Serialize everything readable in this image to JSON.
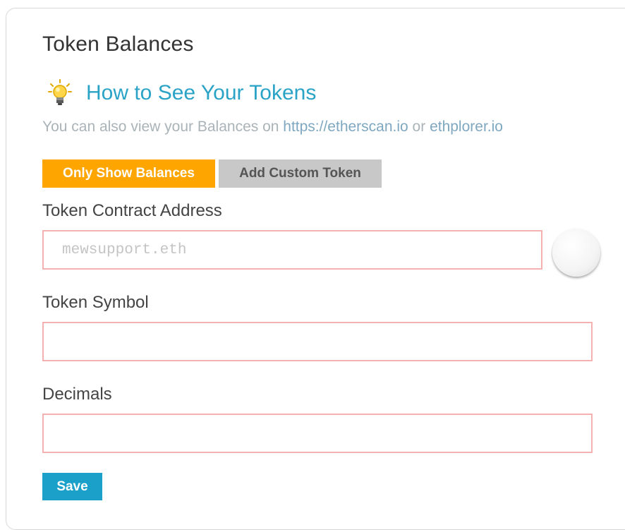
{
  "panel": {
    "title": "Token Balances",
    "help_link": "How to See Your Tokens",
    "info_prefix": "You can also view your Balances on ",
    "info_link_1": "https://etherscan.io",
    "info_middle": " or ",
    "info_link_2": "ethplorer.io"
  },
  "buttons": {
    "only_show_balances": "Only Show Balances",
    "add_custom_token": "Add Custom Token",
    "save": "Save"
  },
  "form": {
    "contract_address_label": "Token Contract Address",
    "contract_address_placeholder": "mewsupport.eth",
    "contract_address_value": "",
    "symbol_label": "Token Symbol",
    "symbol_value": "",
    "decimals_label": "Decimals",
    "decimals_value": ""
  },
  "colors": {
    "accent_orange": "#ffa500",
    "link_blue": "#2aa3c7",
    "save_blue": "#1aa0c9",
    "invalid_border": "#f5b0b0"
  },
  "icons": {
    "help": "lightbulb-icon",
    "address_identicon": "identicon"
  }
}
